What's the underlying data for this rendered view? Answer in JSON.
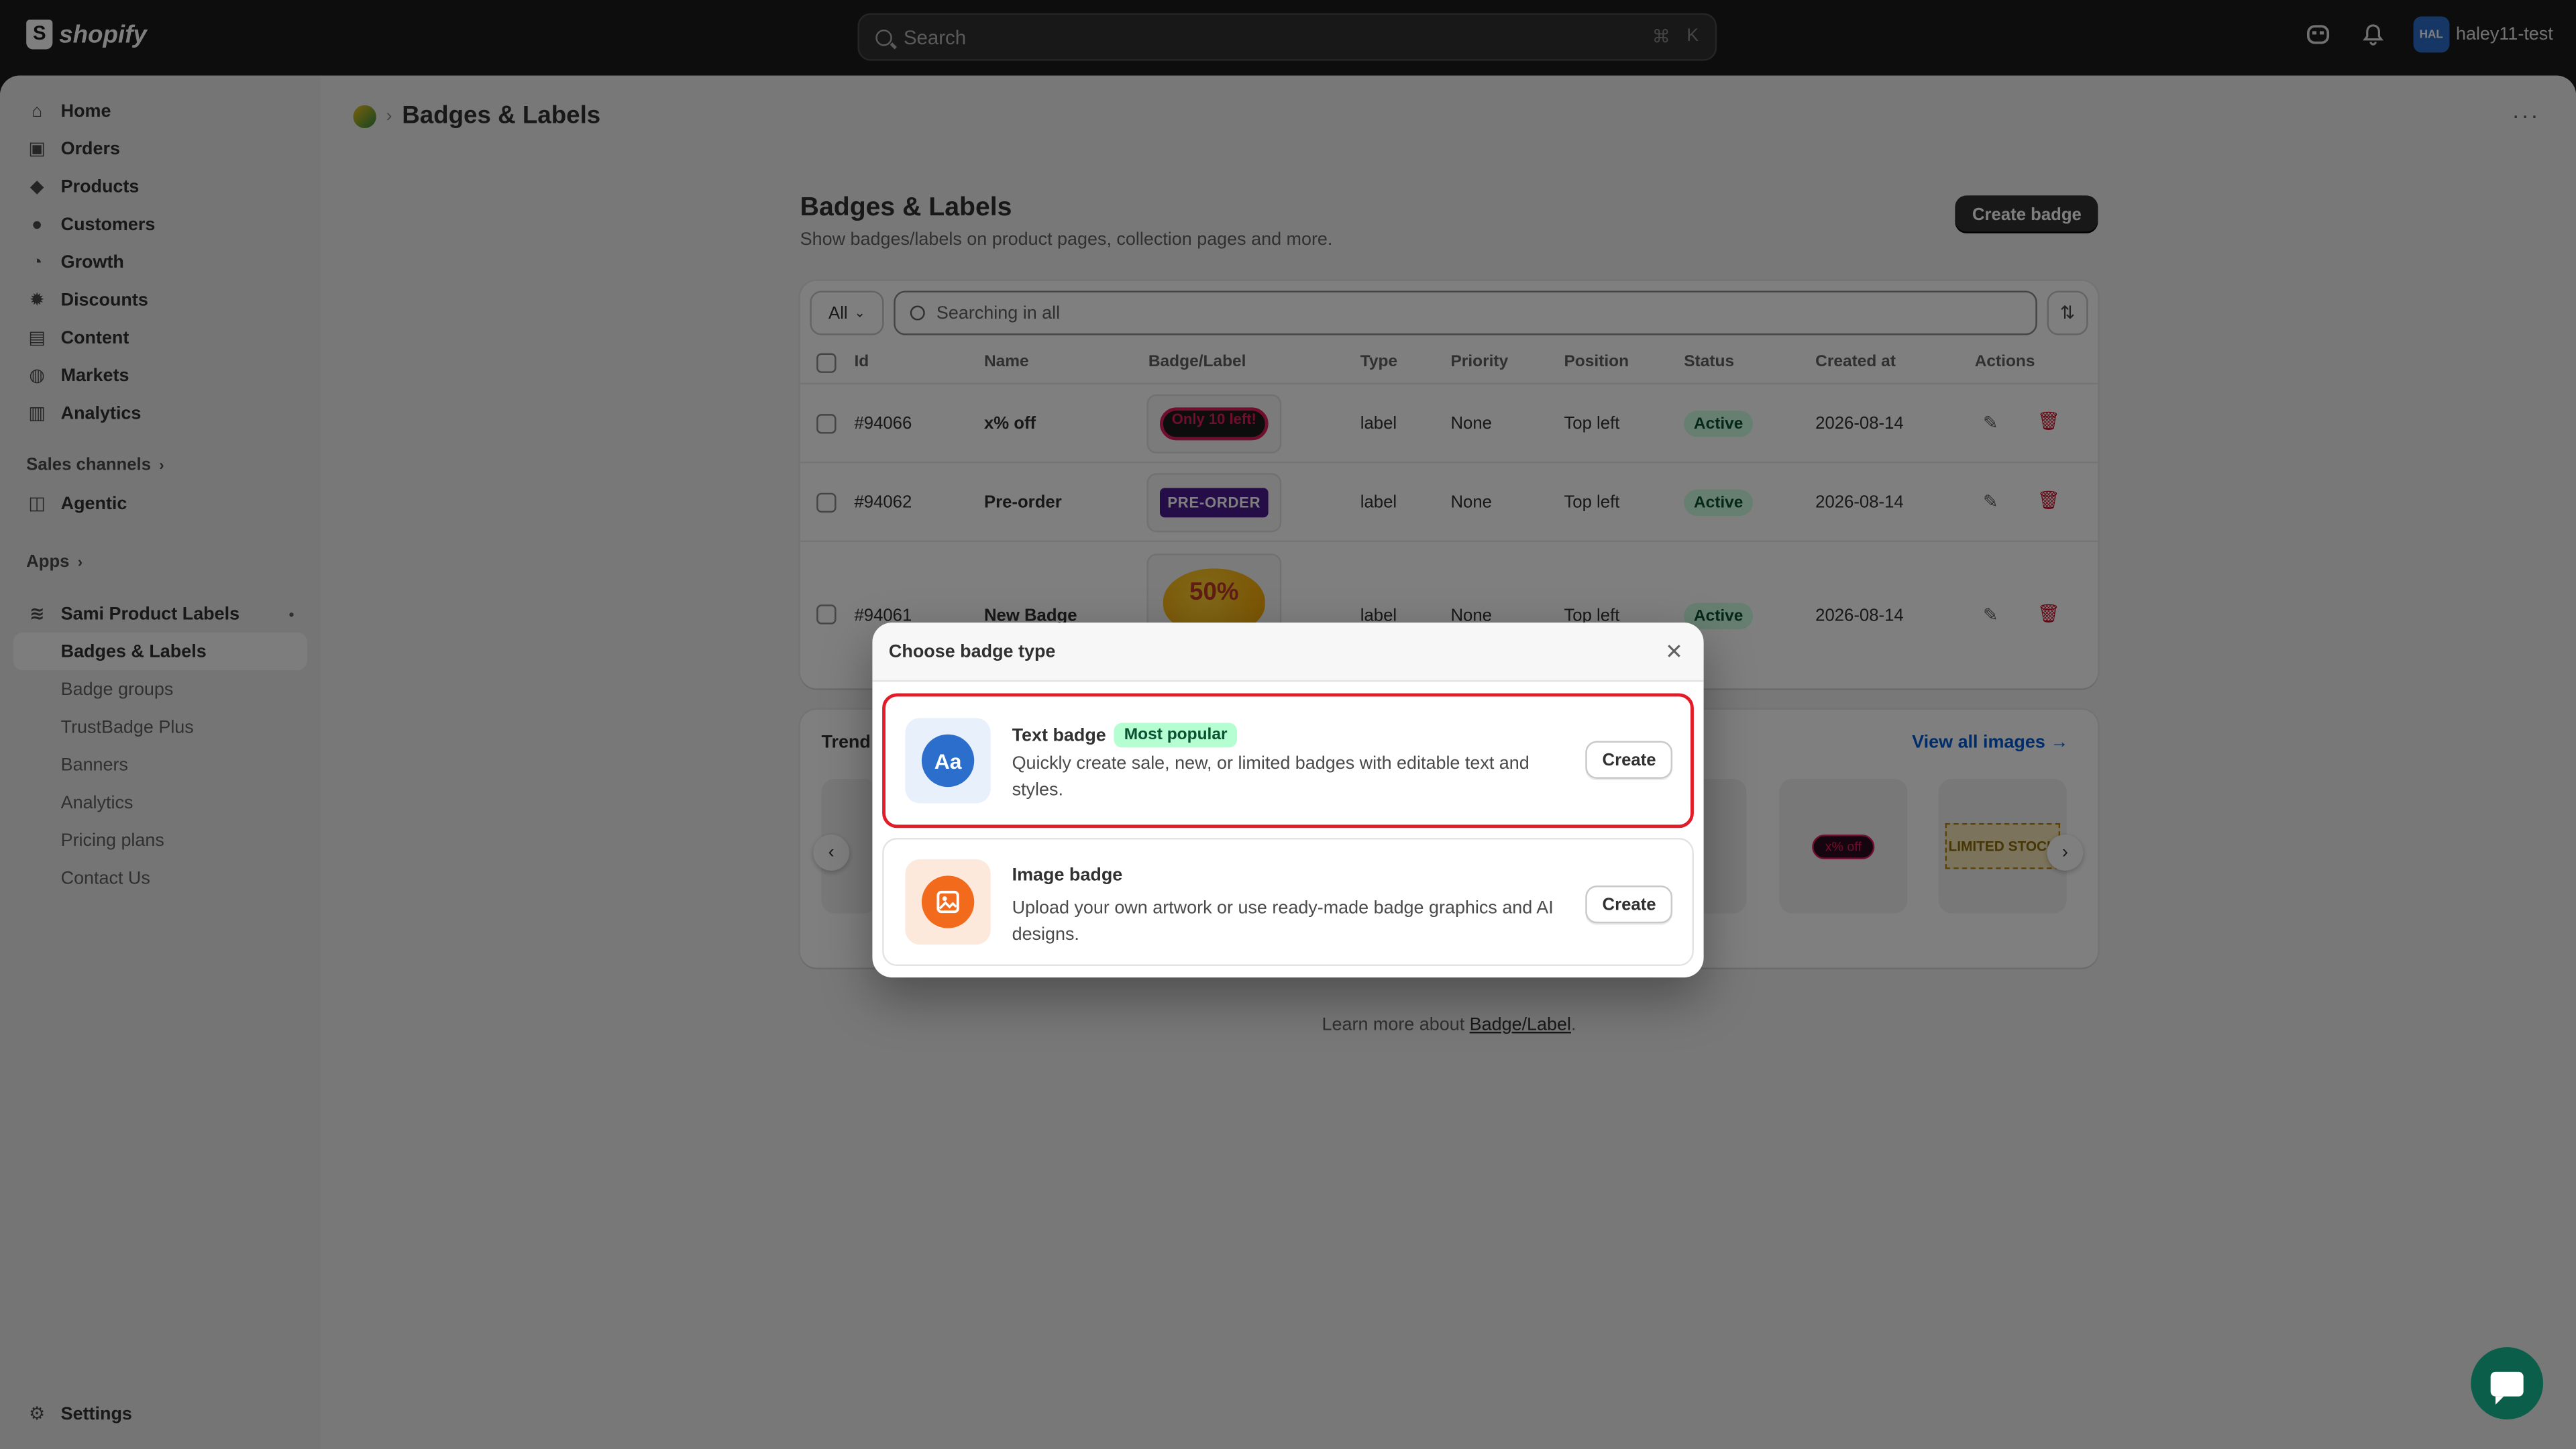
{
  "topbar": {
    "brand": "shopify",
    "search_placeholder": "Search",
    "shortcut_cmd": "⌘",
    "shortcut_key": "K",
    "avatar_initials": "HAL",
    "username": "haley11-test"
  },
  "sidebar": {
    "items": [
      {
        "label": "Home",
        "icon": "home-icon"
      },
      {
        "label": "Orders",
        "icon": "inbox-icon"
      },
      {
        "label": "Products",
        "icon": "tag-icon"
      },
      {
        "label": "Customers",
        "icon": "person-icon"
      },
      {
        "label": "Growth",
        "icon": "gauge-icon"
      },
      {
        "label": "Discounts",
        "icon": "discount-icon"
      },
      {
        "label": "Content",
        "icon": "file-icon"
      },
      {
        "label": "Markets",
        "icon": "globe-icon"
      },
      {
        "label": "Analytics",
        "icon": "bar-chart-icon"
      }
    ],
    "sales_channels_label": "Sales channels",
    "agentic_label": "Agentic",
    "apps_label": "Apps",
    "app_name": "Sami Product Labels",
    "app_subitems": [
      "Badges & Labels",
      "Badge groups",
      "TrustBadge Plus",
      "Banners",
      "Analytics",
      "Pricing plans",
      "Contact Us"
    ],
    "settings_label": "Settings"
  },
  "header": {
    "title": "Badges & Labels"
  },
  "page": {
    "title": "Badges & Labels",
    "subtitle": "Show badges/labels on product pages, collection pages and more.",
    "create_button": "Create badge",
    "filter_all": "All",
    "search_placeholder": "Searching in all",
    "columns": [
      "Id",
      "Name",
      "Badge/Label",
      "Type",
      "Priority",
      "Position",
      "Status",
      "Created at",
      "Actions"
    ],
    "rows": [
      {
        "id": "#94066",
        "name": "x% off",
        "badge_text": "Only 10 left!",
        "type": "label",
        "priority": "None",
        "position": "Top left",
        "status": "Active",
        "created": "2026-08-14"
      },
      {
        "id": "#94062",
        "name": "Pre-order",
        "badge_text": "PRE-ORDER",
        "type": "label",
        "priority": "None",
        "position": "Top left",
        "status": "Active",
        "created": "2026-08-14"
      },
      {
        "id": "#94061",
        "name": "New Badge",
        "badge_text": "50%",
        "type": "label",
        "priority": "None",
        "position": "Top left",
        "status": "Active",
        "created": "2026-08-14"
      }
    ],
    "trending_title": "Trend",
    "view_all": "View all images",
    "tile_xoff": "x% off",
    "tile_limited": "LIMITED STOCK",
    "learn_prefix": "Learn more about ",
    "learn_link": "Badge/Label",
    "learn_suffix": "."
  },
  "modal": {
    "title": "Choose badge type",
    "options": [
      {
        "name": "Text badge",
        "tag": "Most popular",
        "description": "Quickly create sale, new, or limited badges with editable text and styles.",
        "button": "Create",
        "icon_text": "Aa"
      },
      {
        "name": "Image badge",
        "tag": "",
        "description": "Upload your own artwork or use ready-made badge graphics and AI designs.",
        "button": "Create"
      }
    ]
  },
  "colors": {
    "highlight": "#e11d2a",
    "text_icon": "#2c6ecb",
    "image_icon": "#f26b1d",
    "status_bg": "#cdfee1"
  }
}
